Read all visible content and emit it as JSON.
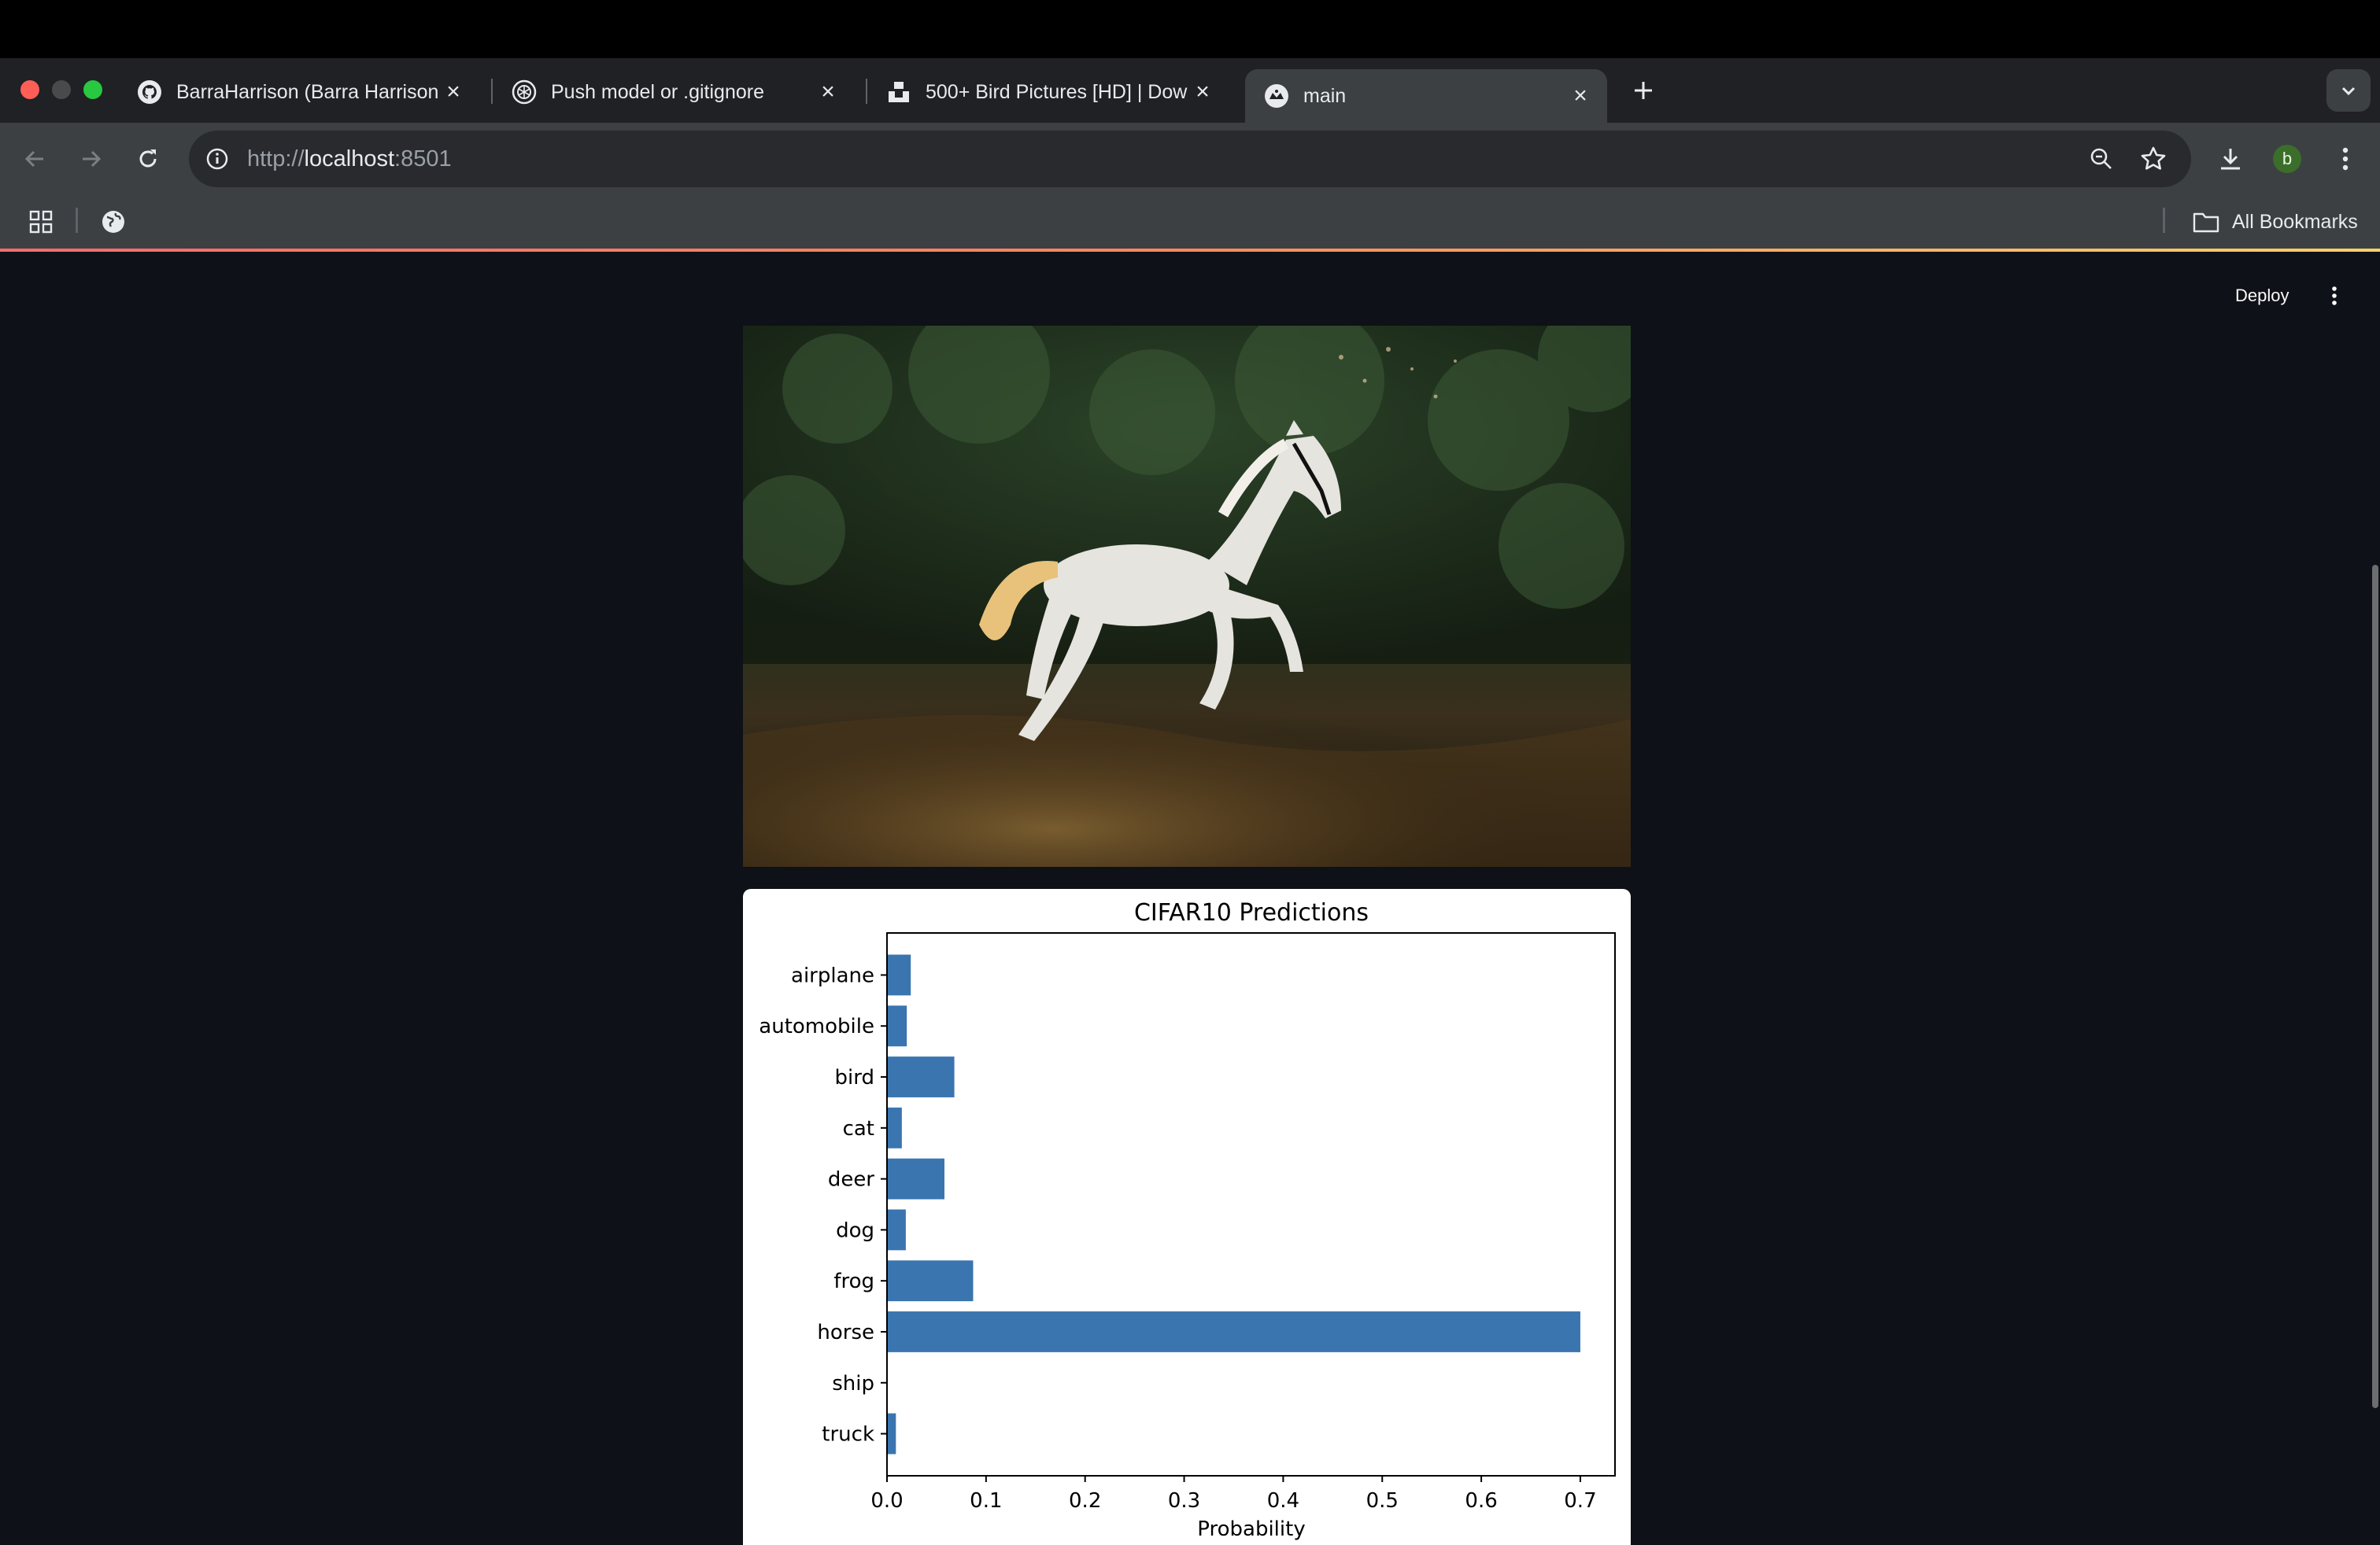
{
  "browser": {
    "tabs": [
      {
        "title": "BarraHarrison (Barra Harrison",
        "icon": "github-icon",
        "active": false
      },
      {
        "title": "Push model or .gitignore",
        "icon": "openai-icon",
        "active": false
      },
      {
        "title": "500+ Bird Pictures [HD] | Dow",
        "icon": "unsplash-icon",
        "active": false
      },
      {
        "title": "main",
        "icon": "streamlit-icon",
        "active": true
      }
    ],
    "url_scheme": "http://",
    "url_host": "localhost",
    "url_port": ":8501",
    "profile_initial": "b",
    "bookmarks_all_label": "All Bookmarks"
  },
  "app": {
    "deploy_label": "Deploy"
  },
  "chart_data": {
    "type": "bar",
    "orientation": "horizontal",
    "title": "CIFAR10 Predictions",
    "xlabel": "Probability",
    "ylabel": "",
    "categories": [
      "airplane",
      "automobile",
      "bird",
      "cat",
      "deer",
      "dog",
      "frog",
      "horse",
      "ship",
      "truck"
    ],
    "values": [
      0.024,
      0.02,
      0.068,
      0.015,
      0.058,
      0.019,
      0.087,
      0.7,
      0.0,
      0.009
    ],
    "xlim": [
      0.0,
      0.735
    ],
    "xticks": [
      "0.0",
      "0.1",
      "0.2",
      "0.3",
      "0.4",
      "0.5",
      "0.6",
      "0.7"
    ],
    "color": "#3a75b0",
    "grid": false,
    "legend": "none"
  }
}
